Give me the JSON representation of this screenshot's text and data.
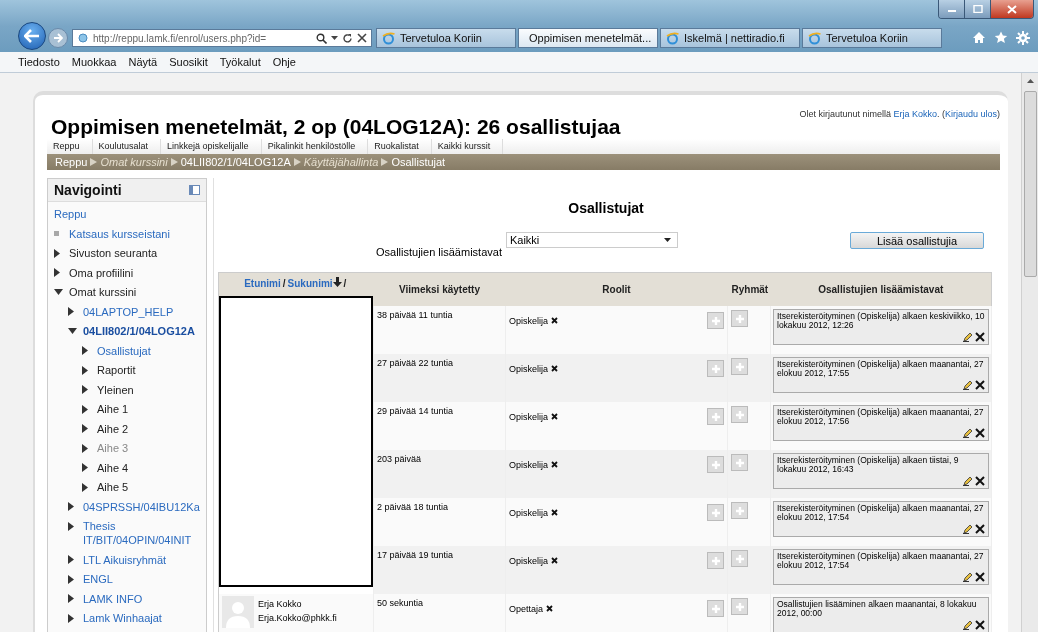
{
  "browser": {
    "address": "http://reppu.lamk.fi/enrol/users.php?id=",
    "tabs": [
      {
        "label": "Tervetuloa Koriin",
        "selected": false,
        "kind": "page"
      },
      {
        "label": "Oppimisen menetelmät...",
        "selected": true,
        "kind": "site"
      },
      {
        "label": "Iskelmä | nettiradio.fi",
        "selected": false,
        "kind": "page"
      },
      {
        "label": "Tervetuloa Koriin",
        "selected": false,
        "kind": "page"
      }
    ],
    "menu": [
      "Tiedosto",
      "Muokkaa",
      "Näytä",
      "Suosikit",
      "Työkalut",
      "Ohje"
    ]
  },
  "page": {
    "title": "Oppimisen menetelmät, 2 op (04LOG12A): 26 osallistujaa",
    "login": [
      {
        "text": "Olet kirjautunut nimellä ",
        "link": false
      },
      {
        "text": "Erja Kokko",
        "link": true
      },
      {
        "text": ". (",
        "link": false
      },
      {
        "text": "Kirjaudu ulos",
        "link": true
      },
      {
        "text": ")",
        "link": false
      }
    ],
    "custom_menu": [
      "Reppu",
      "Koulutusalat",
      "Linkkejä opiskelijalle",
      "Pikalinkit henkilöstölle",
      "Ruokalistat",
      "Kaikki kurssit"
    ],
    "breadcrumb": [
      {
        "label": "Reppu",
        "dimmed": false
      },
      {
        "label": "Omat kurssini",
        "dimmed": true
      },
      {
        "label": "04LII802/1/04LOG12A",
        "dimmed": false
      },
      {
        "label": "Käyttäjähallinta",
        "dimmed": true
      },
      {
        "label": "Osallistujat",
        "dimmed": false
      }
    ]
  },
  "nav": {
    "title": "Navigointi",
    "items": [
      {
        "label": "Reppu",
        "kind": "home",
        "link": true
      },
      {
        "label": "Katsaus kursseistani",
        "kind": "leaf",
        "link": true
      },
      {
        "label": "Sivuston seuranta",
        "kind": "branch",
        "link": false,
        "expanded": false
      },
      {
        "label": "Oma profiilini",
        "kind": "branch",
        "link": false,
        "expanded": false
      },
      {
        "label": "Omat kurssini",
        "kind": "branch",
        "link": false,
        "expanded": true,
        "children": [
          {
            "label": "04LAPTOP_HELP",
            "kind": "branch",
            "link": true,
            "expanded": false
          },
          {
            "label": "04LII802/1/04LOG12A",
            "kind": "branch",
            "link": true,
            "expanded": true,
            "current": true,
            "children": [
              {
                "label": "Osallistujat",
                "kind": "branch",
                "link": true,
                "expanded": false
              },
              {
                "label": "Raportit",
                "kind": "branch",
                "link": false,
                "expanded": false
              },
              {
                "label": "Yleinen",
                "kind": "branch",
                "link": false,
                "expanded": false
              },
              {
                "label": "Aihe 1",
                "kind": "branch",
                "link": false,
                "expanded": false
              },
              {
                "label": "Aihe 2",
                "kind": "branch",
                "link": false,
                "expanded": false
              },
              {
                "label": "Aihe 3",
                "kind": "branch",
                "link": false,
                "expanded": false,
                "dimmed": true
              },
              {
                "label": "Aihe 4",
                "kind": "branch",
                "link": false,
                "expanded": false
              },
              {
                "label": "Aihe 5",
                "kind": "branch",
                "link": false,
                "expanded": false
              }
            ]
          },
          {
            "label": "04SPRSSH/04IBU12Ka",
            "kind": "branch",
            "link": true,
            "expanded": false
          },
          {
            "label": "Thesis IT/BIT/04OPIN/04INIT",
            "kind": "branch",
            "link": true,
            "expanded": false
          },
          {
            "label": "LTL Aikuisryhmät",
            "kind": "branch",
            "link": true,
            "expanded": false
          },
          {
            "label": "ENGL",
            "kind": "branch",
            "link": true,
            "expanded": false
          },
          {
            "label": "LAMK INFO",
            "kind": "branch",
            "link": true,
            "expanded": false
          },
          {
            "label": "Lamk Winhaajat",
            "kind": "branch",
            "link": true,
            "expanded": false
          }
        ]
      }
    ]
  },
  "main": {
    "heading": "Osallistujat",
    "filter_label": "Osallistujien lisäämistavat",
    "filter_value": "Kaikki",
    "add_button": "Lisää osallistujia",
    "columns": {
      "name_header": [
        {
          "text": "Etunimi",
          "link": true,
          "sorted": false
        },
        {
          "text": "/",
          "link": false,
          "sorted": false
        },
        {
          "text": "Sukunimi",
          "link": true,
          "sorted": true
        },
        {
          "text": "/",
          "link": false,
          "sorted": false
        }
      ],
      "last_access": "Viimeksi käytetty",
      "roles": "Roolit",
      "groups": "Ryhmät",
      "enrolment": "Osallistujien lisäämistavat"
    },
    "rows": [
      {
        "redacted": true,
        "last_access": "38 päivää 11 tuntia",
        "role": "Opiskelija",
        "enrolment": "Itserekisteröityminen (Opiskelija) alkaen keskiviikko, 10 lokakuu 2012, 12:26"
      },
      {
        "redacted": true,
        "last_access": "27 päivää 22 tuntia",
        "role": "Opiskelija",
        "enrolment": "Itserekisteröityminen (Opiskelija) alkaen maanantai, 27 elokuu 2012, 17:55"
      },
      {
        "redacted": true,
        "last_access": "29 päivää 14 tuntia",
        "role": "Opiskelija",
        "enrolment": "Itserekisteröityminen (Opiskelija) alkaen maanantai, 27 elokuu 2012, 17:56"
      },
      {
        "redacted": true,
        "last_access": "203 päivää",
        "role": "Opiskelija",
        "enrolment": "Itserekisteröityminen (Opiskelija) alkaen tiistai, 9 lokakuu 2012, 16:43"
      },
      {
        "redacted": true,
        "last_access": "2 päivää 18 tuntia",
        "role": "Opiskelija",
        "enrolment": "Itserekisteröityminen (Opiskelija) alkaen maanantai, 27 elokuu 2012, 17:54"
      },
      {
        "redacted": true,
        "last_access": "17 päivää 19 tuntia",
        "role": "Opiskelija",
        "enrolment": "Itserekisteröityminen (Opiskelija) alkaen maanantai, 27 elokuu 2012, 17:54"
      },
      {
        "redacted": false,
        "name": "Erja Kokko",
        "email": "Erja.Kokko@phkk.fi",
        "last_access": "50 sekuntia",
        "role": "Opettaja",
        "enrolment": "Osallistujien lisääminen alkaen maanantai, 8 lokakuu 2012, 00:00"
      }
    ]
  }
}
